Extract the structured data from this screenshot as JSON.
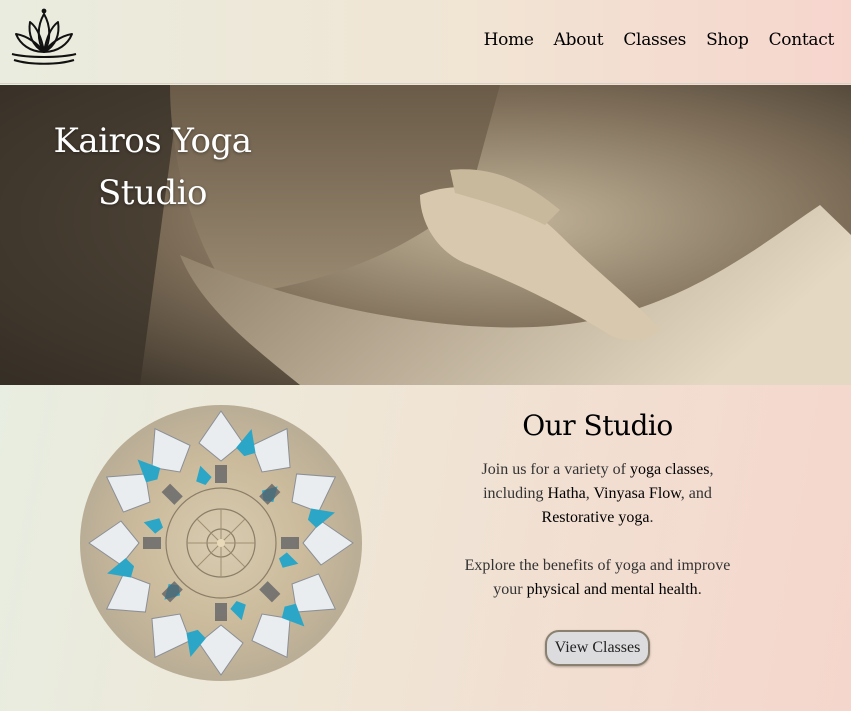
{
  "header": {
    "logo": "lotus-logo",
    "nav": [
      "Home",
      "About",
      "Classes",
      "Shop",
      "Contact"
    ]
  },
  "hero": {
    "title_line1": "Kairos Yoga",
    "title_line2": "Studio"
  },
  "studio": {
    "heading": "Our Studio",
    "p1": {
      "t1": "Join us for a variety of ",
      "b1": "yoga classes",
      "t2": ", including ",
      "b2": "Hatha",
      "t3": ", ",
      "b3": "Vinyasa Flow",
      "t4": ", and ",
      "b4": "Restorative yoga",
      "t5": "."
    },
    "p2": {
      "t1": "Explore the benefits of yoga and improve your ",
      "b1": "physical and mental health",
      "t2": "."
    },
    "button": "View Classes"
  },
  "colors": {
    "accent_teal": "#2ba6c6",
    "hero_sepia": "#6b5c4a"
  }
}
